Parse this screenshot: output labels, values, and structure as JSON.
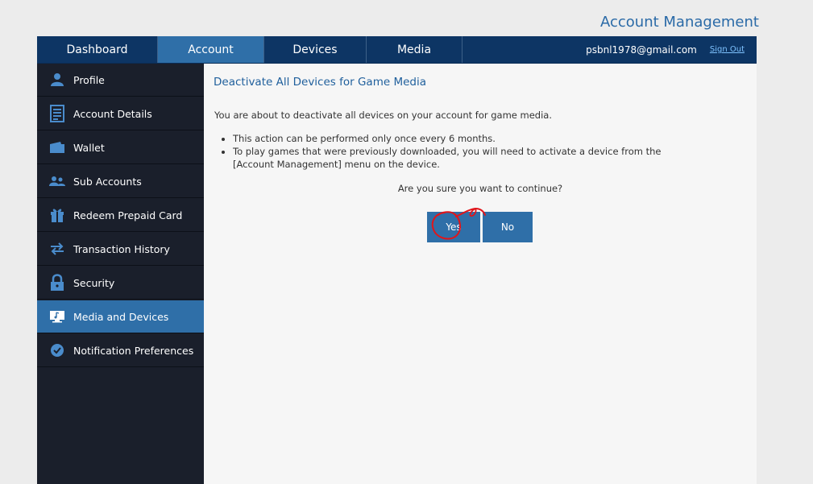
{
  "header": {
    "title": "Account Management"
  },
  "topnav": {
    "tabs": [
      {
        "label": "Dashboard"
      },
      {
        "label": "Account"
      },
      {
        "label": "Devices"
      },
      {
        "label": "Media"
      }
    ],
    "active_tab": "Account",
    "user_email": "psbnl1978@gmail.com",
    "sign_out": "Sign Out"
  },
  "sidebar": {
    "items": [
      {
        "label": "Profile",
        "icon": "user-icon"
      },
      {
        "label": "Account Details",
        "icon": "document-icon"
      },
      {
        "label": "Wallet",
        "icon": "wallet-icon"
      },
      {
        "label": "Sub Accounts",
        "icon": "users-icon"
      },
      {
        "label": "Redeem Prepaid Card",
        "icon": "gift-icon"
      },
      {
        "label": "Transaction History",
        "icon": "swap-arrows-icon"
      },
      {
        "label": "Security",
        "icon": "lock-icon"
      },
      {
        "label": "Media and Devices",
        "icon": "media-device-icon"
      },
      {
        "label": "Notification Preferences",
        "icon": "badge-icon"
      }
    ],
    "active_item": "Media and Devices"
  },
  "main": {
    "heading": "Deactivate All Devices for Game Media",
    "intro": "You are about to deactivate all devices on your account for game media.",
    "bullets": [
      "This action can be performed only once every 6 months.",
      "To play games that were previously downloaded, you will need to activate a device from the [Account Management] menu on the device."
    ],
    "question": "Are you sure you want to continue?",
    "yes_label": "Yes",
    "no_label": "No"
  },
  "colors": {
    "nav_bg": "#0d3564",
    "accent": "#2f6fa8",
    "sidebar_bg": "#1a1f2b",
    "annotation": "#e0161b"
  }
}
